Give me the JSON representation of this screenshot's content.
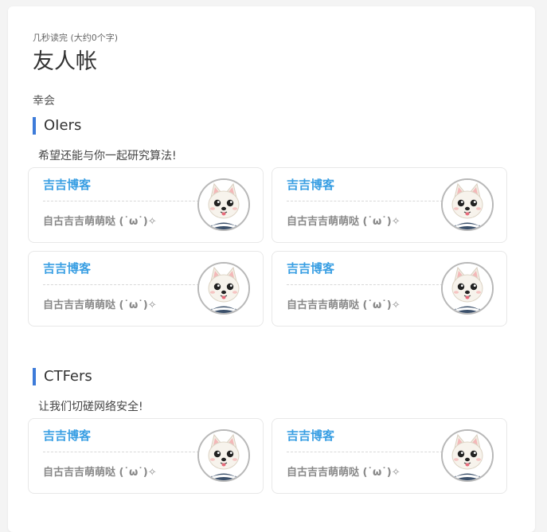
{
  "page": {
    "meta": "几秒读完 (大约0个字)",
    "title": "友人帐",
    "intro": "幸会"
  },
  "sections": [
    {
      "title": "OIers",
      "desc": "希望还能与你一起研究算法!",
      "friends": [
        {
          "name": "吉吉博客",
          "desc": "自古吉吉萌萌哒 (˙ω˙)✧",
          "avatar_icon": "dog-avatar-icon"
        },
        {
          "name": "吉吉博客",
          "desc": "自古吉吉萌萌哒 (˙ω˙)✧",
          "avatar_icon": "dog-avatar-icon"
        },
        {
          "name": "吉吉博客",
          "desc": "自古吉吉萌萌哒 (˙ω˙)✧",
          "avatar_icon": "dog-avatar-icon"
        },
        {
          "name": "吉吉博客",
          "desc": "自古吉吉萌萌哒 (˙ω˙)✧",
          "avatar_icon": "dog-avatar-icon"
        }
      ]
    },
    {
      "title": "CTFers",
      "desc": "让我们切磋网络安全!",
      "friends": [
        {
          "name": "吉吉博客",
          "desc": "自古吉吉萌萌哒 (˙ω˙)✧",
          "avatar_icon": "dog-avatar-icon"
        },
        {
          "name": "吉吉博客",
          "desc": "自古吉吉萌萌哒 (˙ω˙)✧",
          "avatar_icon": "dog-avatar-icon"
        }
      ]
    }
  ],
  "colors": {
    "accent": "#3d7bd9",
    "link": "#3a9fe3",
    "muted": "#888888"
  }
}
